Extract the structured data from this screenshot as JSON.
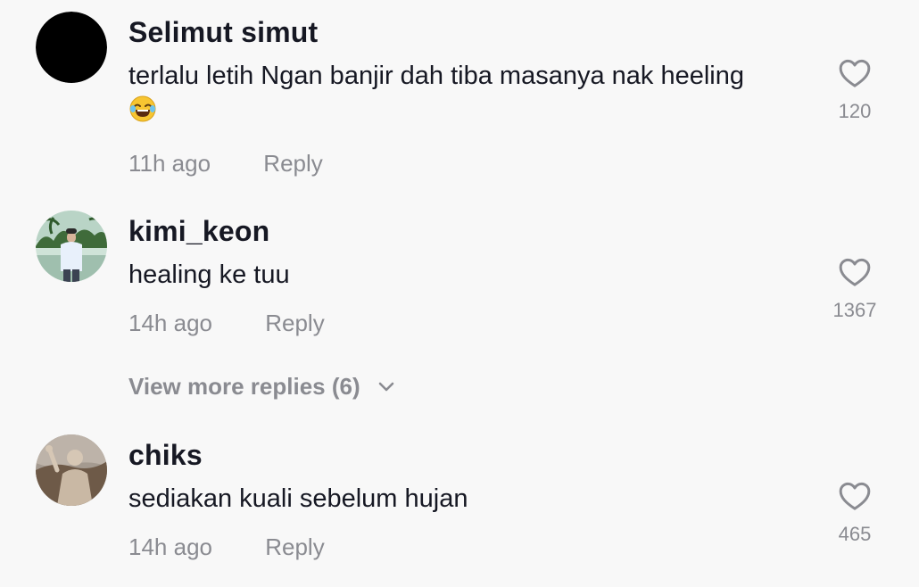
{
  "comments": [
    {
      "username": "Selimut simut",
      "text": "terlalu letih Ngan banjir dah tiba masanya nak heeling",
      "emoji": "😂",
      "time": "11h ago",
      "reply_label": "Reply",
      "likes": "120",
      "avatar_icon": "black-circle-avatar"
    },
    {
      "username": "kimi_keon",
      "text": "healing ke tuu",
      "time": "14h ago",
      "reply_label": "Reply",
      "likes": "1367",
      "avatar_icon": "photo-avatar-man-palm-trees"
    },
    {
      "username": "chiks",
      "text": "sediakan kuali sebelum hujan",
      "time": "14h ago",
      "reply_label": "Reply",
      "likes": "465",
      "avatar_icon": "photo-avatar-figure-sepia"
    }
  ],
  "view_more_replies": "View more replies (6)",
  "colors": {
    "background": "#f8f8f8",
    "primary_text": "#161823",
    "secondary_text": "#8a8b91"
  }
}
